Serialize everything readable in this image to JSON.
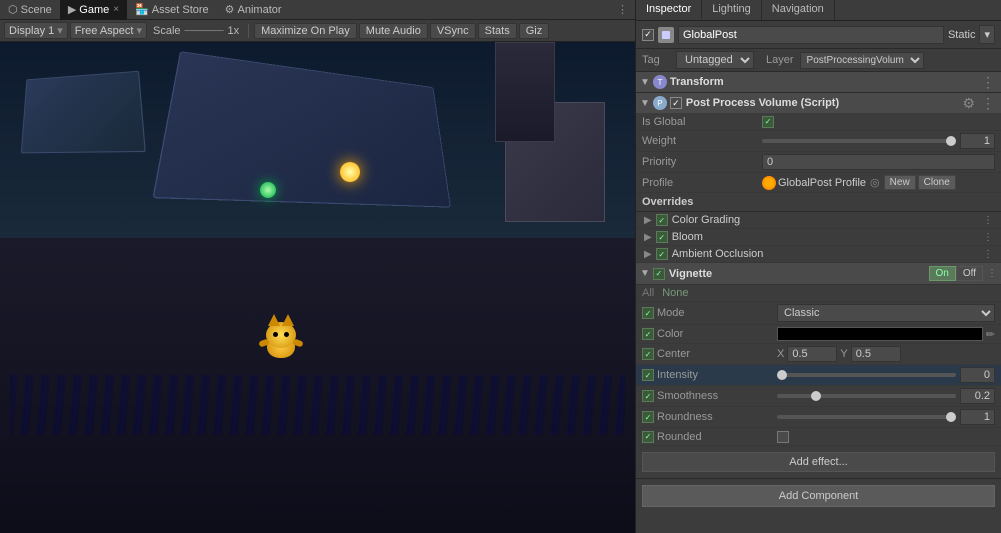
{
  "window": {
    "tabs": [
      {
        "id": "scene",
        "label": "Scene",
        "icon": "scene-icon",
        "active": false
      },
      {
        "id": "game",
        "label": "Game",
        "icon": "game-icon",
        "active": true
      },
      {
        "id": "asset-store",
        "label": "Asset Store",
        "icon": "store-icon",
        "active": false
      },
      {
        "id": "animator",
        "label": "Animator",
        "icon": "animator-icon",
        "active": false
      }
    ]
  },
  "game_toolbar": {
    "display": "Display 1",
    "aspect": "Free Aspect",
    "scale_label": "Scale",
    "scale_value": "1x",
    "maximize": "Maximize On Play",
    "mute": "Mute Audio",
    "vsync": "VSync",
    "stats": "Stats",
    "gizmos": "Giz"
  },
  "inspector": {
    "title": "Inspector",
    "tabs": [
      {
        "label": "Inspector",
        "active": true
      },
      {
        "label": "Lighting",
        "active": false
      },
      {
        "label": "Navigation",
        "active": false
      }
    ],
    "object": {
      "checkbox_checked": true,
      "name": "GlobalPost",
      "static_label": "Static",
      "tag_label": "Tag",
      "tag_value": "Untagged",
      "layer_label": "Layer",
      "layer_value": "PostProcessingVolum"
    },
    "transform": {
      "title": "Transform",
      "expand_icon": "▼"
    },
    "post_process_volume": {
      "title": "Post Process Volume (Script)",
      "is_global_label": "Is Global",
      "is_global_checked": true,
      "weight_label": "Weight",
      "weight_value": "1",
      "priority_label": "Priority",
      "priority_value": "0",
      "profile_label": "Profile",
      "profile_name": "GlobalPost Profile",
      "new_btn": "New",
      "clone_btn": "Clone"
    },
    "overrides": {
      "title": "Overrides",
      "items": [
        {
          "label": "Color Grading",
          "checked": true
        },
        {
          "label": "Bloom",
          "checked": true
        },
        {
          "label": "Ambient Occlusion",
          "checked": true
        }
      ]
    },
    "vignette": {
      "title": "Vignette",
      "on_label": "On",
      "off_label": "Off",
      "all_label": "All",
      "none_label": "None",
      "mode_label": "Mode",
      "mode_value": "Classic",
      "color_label": "Color",
      "color_value": "#000000",
      "center_label": "Center",
      "center_x_label": "X",
      "center_x_value": "0.5",
      "center_y_label": "Y",
      "center_y_value": "0.5",
      "intensity_label": "Intensity",
      "intensity_value": "0",
      "intensity_slider": 0,
      "smoothness_label": "Smoothness",
      "smoothness_value": "0.2",
      "smoothness_slider": 20,
      "roundness_label": "Roundness",
      "roundness_value": "1",
      "roundness_slider": 100,
      "rounded_label": "Rounded",
      "rounded_checked": false
    },
    "add_effect_btn": "Add effect...",
    "add_component_btn": "Add Component"
  }
}
